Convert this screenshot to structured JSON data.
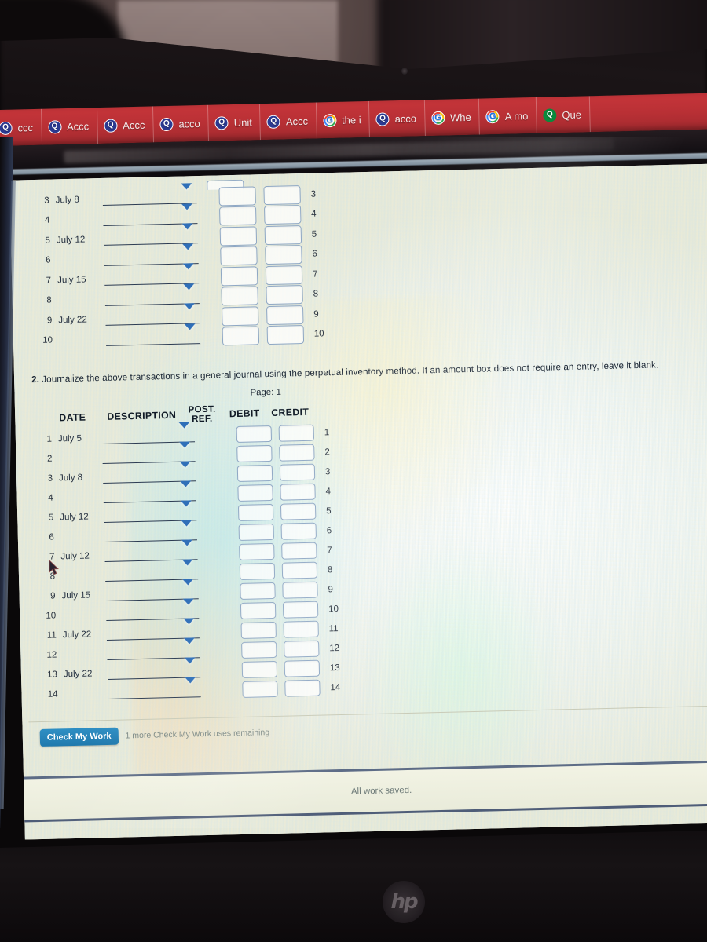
{
  "browser": {
    "tabs": [
      {
        "label": "ccc",
        "icon": "quizlet-q-icon"
      },
      {
        "label": "Accc",
        "icon": "quizlet-q-icon"
      },
      {
        "label": "Accc",
        "icon": "quizlet-q-icon"
      },
      {
        "label": "acco",
        "icon": "quizlet-q-icon"
      },
      {
        "label": "Unit",
        "icon": "quizlet-q-icon"
      },
      {
        "label": "Accc",
        "icon": "quizlet-q-icon"
      },
      {
        "label": "the i",
        "icon": "google-g-icon"
      },
      {
        "label": "acco",
        "icon": "quizlet-q-icon"
      },
      {
        "label": "Whe",
        "icon": "google-g-icon"
      },
      {
        "label": "A mo",
        "icon": "google-g-icon"
      },
      {
        "label": "Que",
        "icon": "quizlet-green-q-icon"
      }
    ]
  },
  "top_table": {
    "rows": [
      {
        "num": "3",
        "date": "July 8",
        "right_num": "3"
      },
      {
        "num": "4",
        "date": "",
        "right_num": "4"
      },
      {
        "num": "5",
        "date": "July 12",
        "right_num": "5"
      },
      {
        "num": "6",
        "date": "",
        "right_num": "6"
      },
      {
        "num": "7",
        "date": "July 15",
        "right_num": "7"
      },
      {
        "num": "8",
        "date": "",
        "right_num": "8"
      },
      {
        "num": "9",
        "date": "July 22",
        "right_num": "9"
      },
      {
        "num": "10",
        "date": "",
        "right_num": "10"
      }
    ]
  },
  "instruction": {
    "number": "2.",
    "text": "Journalize the above transactions in a general journal using the perpetual inventory method. If an amount box does not require an entry, leave it blank."
  },
  "journal": {
    "page_label": "Page: 1",
    "headers": {
      "date": "DATE",
      "description": "DESCRIPTION",
      "post_ref_line1": "POST.",
      "post_ref_line2": "REF.",
      "debit": "DEBIT",
      "credit": "CREDIT"
    },
    "rows": [
      {
        "num": "1",
        "date": "July 5",
        "right_num": "1"
      },
      {
        "num": "2",
        "date": "",
        "right_num": "2"
      },
      {
        "num": "3",
        "date": "July 8",
        "right_num": "3"
      },
      {
        "num": "4",
        "date": "",
        "right_num": "4"
      },
      {
        "num": "5",
        "date": "July 12",
        "right_num": "5"
      },
      {
        "num": "6",
        "date": "",
        "right_num": "6"
      },
      {
        "num": "7",
        "date": "July 12",
        "right_num": "7"
      },
      {
        "num": "8",
        "date": "",
        "right_num": "8"
      },
      {
        "num": "9",
        "date": "July 15",
        "right_num": "9"
      },
      {
        "num": "10",
        "date": "",
        "right_num": "10"
      },
      {
        "num": "11",
        "date": "July 22",
        "right_num": "11"
      },
      {
        "num": "12",
        "date": "",
        "right_num": "12"
      },
      {
        "num": "13",
        "date": "July 22",
        "right_num": "13"
      },
      {
        "num": "14",
        "date": "",
        "right_num": "14"
      }
    ]
  },
  "check_my_work": {
    "button_label": "Check My Work",
    "note": "1 more Check My Work uses remaining"
  },
  "footer": {
    "saved_text": "All work saved."
  },
  "laptop": {
    "brand": "hp"
  },
  "colors": {
    "tab_bar_red": "#b93035",
    "check_button_blue": "#2079ad",
    "caret_blue": "#2f6fb8",
    "input_border": "#8ea7c4"
  }
}
